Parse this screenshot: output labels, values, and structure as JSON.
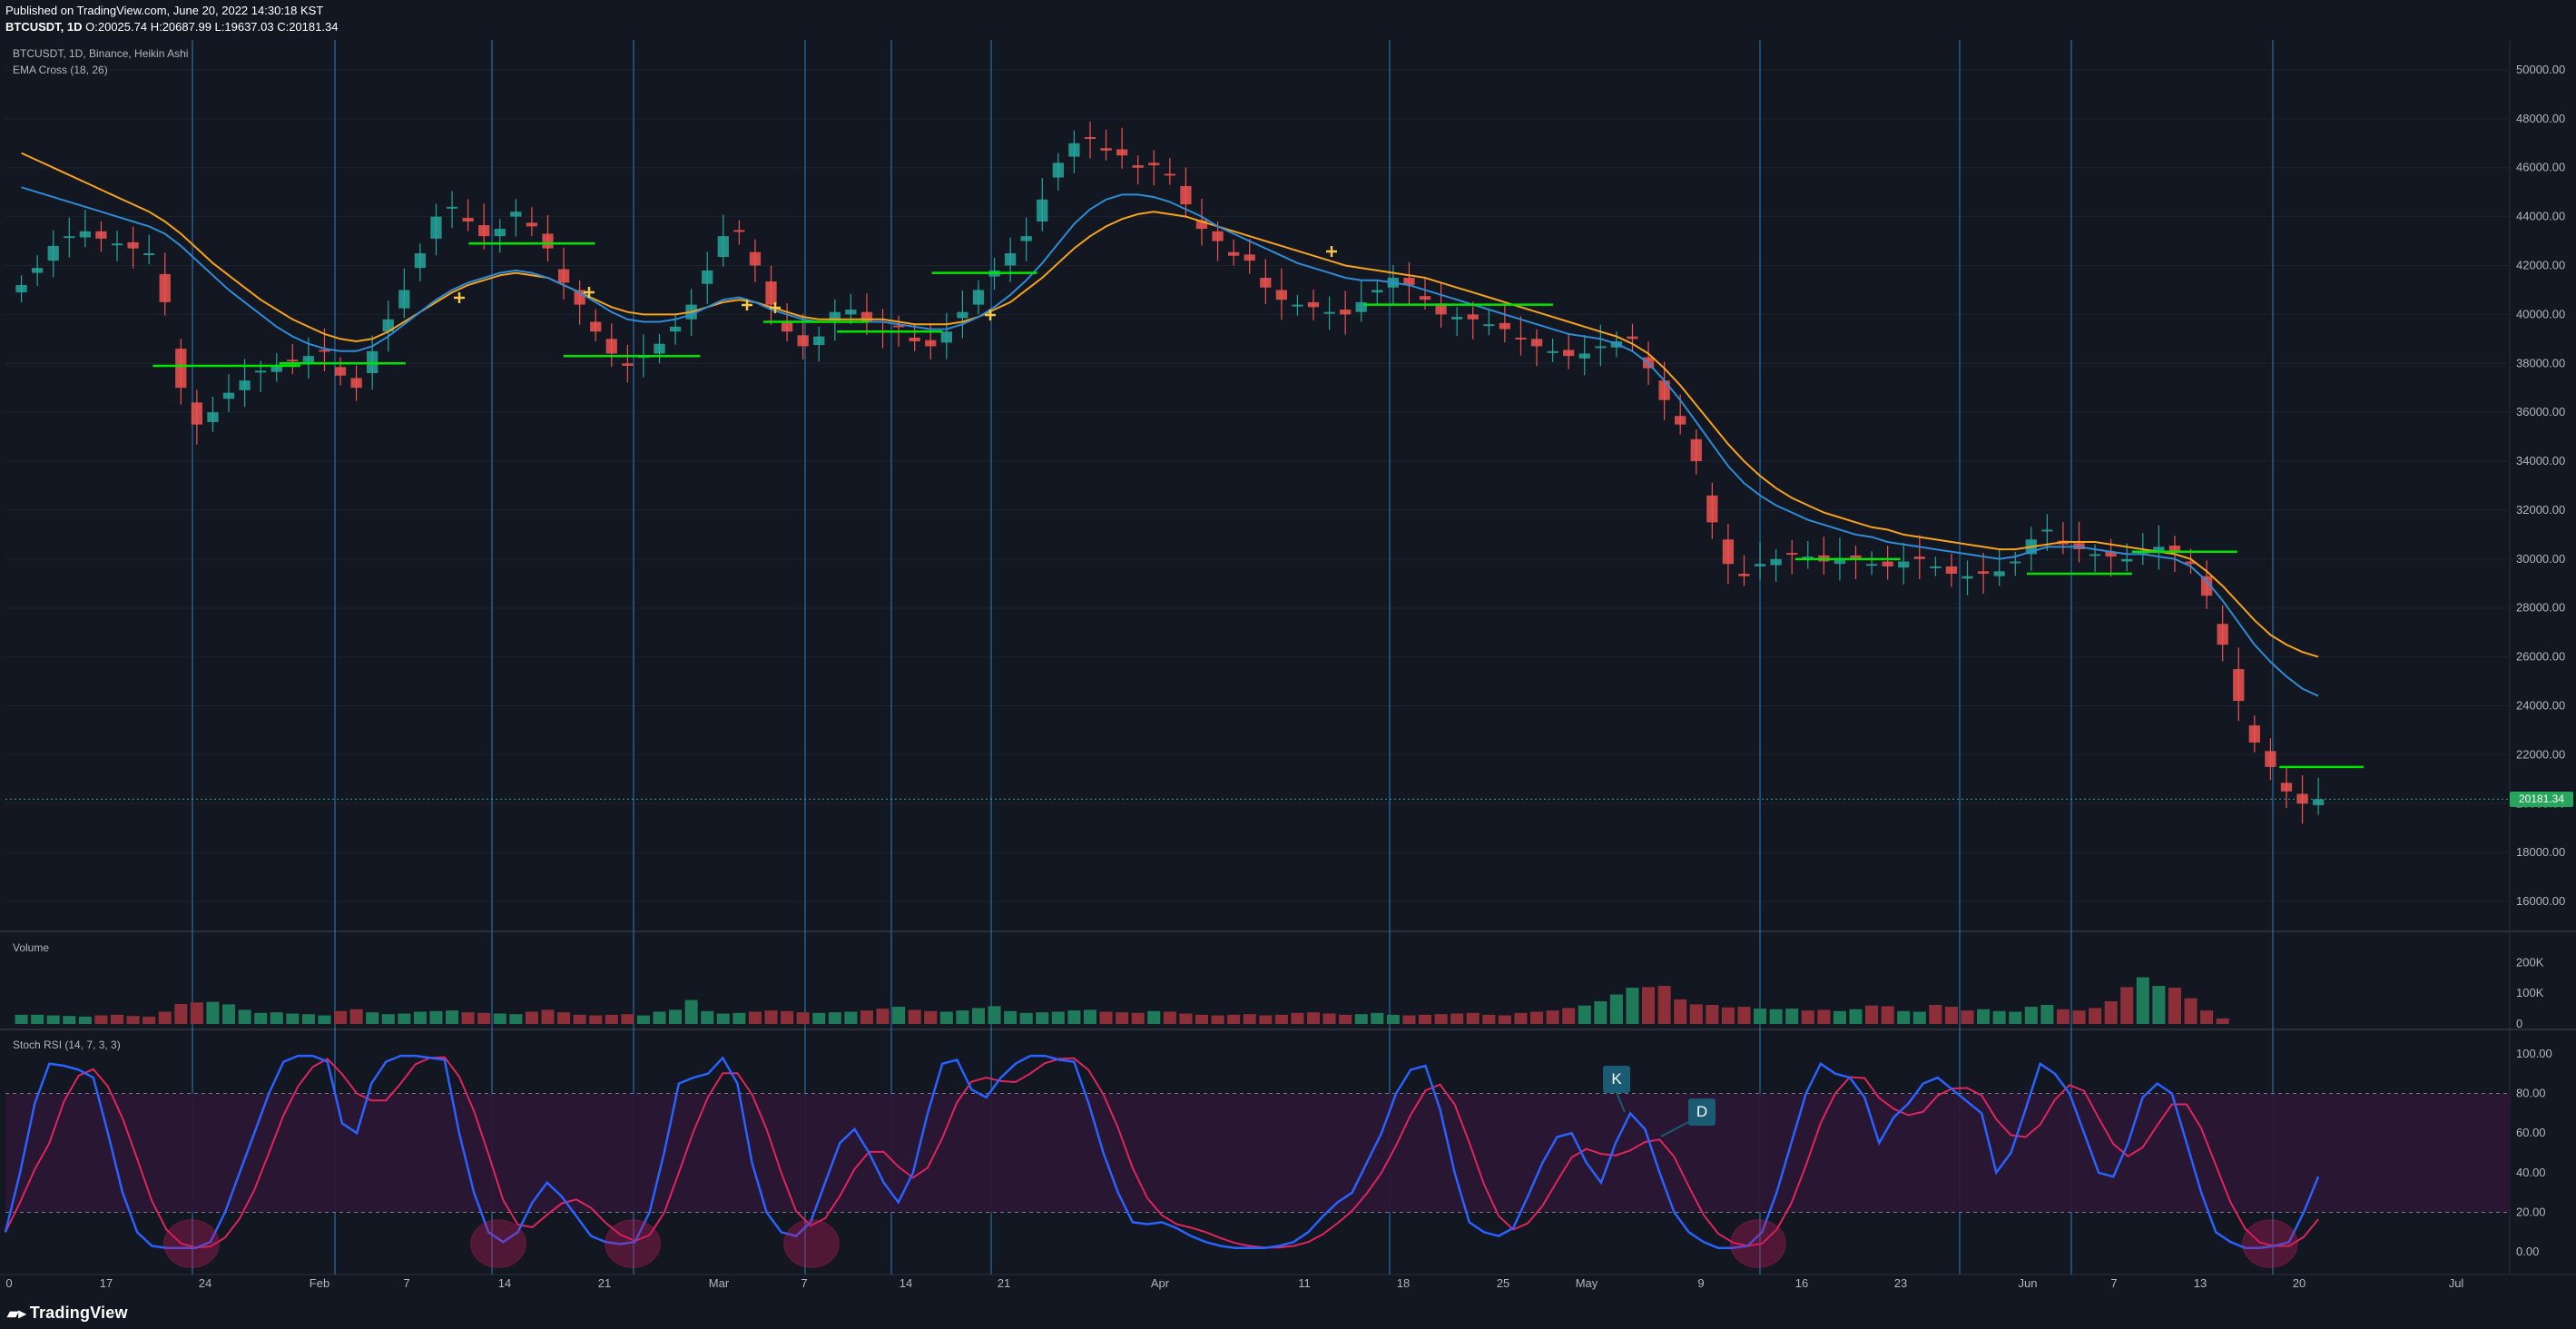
{
  "header": {
    "published": "Published on TradingView.com, June 20, 2022 14:30:18 KST",
    "symbol": "BTCUSDT, 1D",
    "ohlc": "O:20025.74 H:20687.99 L:19637.03 C:20181.34"
  },
  "legend": {
    "main": "BTCUSDT, 1D, Binance, Heikin Ashi",
    "ema": "EMA Cross (18, 26)",
    "volume": "Volume",
    "stoch": "Stoch RSI (14, 7, 3, 3)"
  },
  "price_axis": [
    "50000.00",
    "48000.00",
    "46000.00",
    "44000.00",
    "42000.00",
    "40000.00",
    "38000.00",
    "36000.00",
    "34000.00",
    "32000.00",
    "30000.00",
    "28000.00",
    "26000.00",
    "24000.00",
    "22000.00",
    "20000.00",
    "18000.00",
    "16000.00"
  ],
  "last_price": "20181.34",
  "volume_axis": [
    "200K",
    "100K",
    "0"
  ],
  "stoch_axis": [
    "100.00",
    "80.00",
    "60.00",
    "40.00",
    "20.00",
    "0.00"
  ],
  "time_axis": [
    "0",
    "17",
    "24",
    "Feb",
    "7",
    "14",
    "21",
    "Mar",
    "7",
    "14",
    "21",
    "Apr",
    "11",
    "18",
    "25",
    "May",
    "9",
    "16",
    "23",
    "Jun",
    "7",
    "13",
    "20",
    "Jul"
  ],
  "callouts": {
    "k": "K",
    "d": "D"
  },
  "footer": {
    "brand": "TradingView"
  },
  "colors": {
    "up": "#26a69a",
    "down": "#ef5350",
    "ema_fast": "#2e8bd6",
    "ema_slow": "#f7a21b",
    "support": "#00e600",
    "k": "#2962ff",
    "d": "#e0245e"
  },
  "chart_data": {
    "type": "candlestick",
    "price_ylim": [
      15000,
      51000
    ],
    "price_series": [
      41200,
      41900,
      42800,
      43200,
      43400,
      43100,
      42900,
      42700,
      42500,
      40500,
      37000,
      35500,
      36000,
      36800,
      37300,
      37700,
      37900,
      38100,
      38300,
      38500,
      37500,
      37000,
      38500,
      39800,
      41000,
      42500,
      44000,
      44400,
      43800,
      43200,
      43500,
      44200,
      43600,
      42700,
      41300,
      40400,
      39300,
      38400,
      37900,
      38300,
      38800,
      39500,
      40400,
      41800,
      43200,
      43400,
      42000,
      40400,
      39300,
      38700,
      39100,
      40100,
      40200,
      39700,
      39300,
      39500,
      38900,
      38700,
      39300,
      40100,
      41000,
      41800,
      42500,
      43200,
      44700,
      46200,
      47000,
      47200,
      46700,
      46500,
      46000,
      46100,
      45700,
      44500,
      43500,
      43000,
      42400,
      42200,
      41100,
      40600,
      40400,
      40300,
      40100,
      40000,
      40500,
      41000,
      41500,
      41200,
      40600,
      40000,
      39900,
      39800,
      39600,
      39400,
      39000,
      38700,
      38500,
      38300,
      38400,
      38700,
      38900,
      39000,
      37800,
      36500,
      35500,
      34000,
      31500,
      29800,
      29300,
      29800,
      30000,
      30200,
      30100,
      29900,
      30000,
      30000,
      29800,
      29700,
      29900,
      30000,
      29700,
      29400,
      29300,
      29400,
      29500,
      29900,
      30800,
      31200,
      30600,
      30400,
      30200,
      30100,
      30000,
      30300,
      30500,
      30300,
      29800,
      28500,
      26500,
      24200,
      22500,
      21500,
      20500,
      20000,
      20181
    ],
    "ema_fast": [
      45200,
      45000,
      44800,
      44600,
      44400,
      44200,
      44000,
      43800,
      43600,
      43300,
      42800,
      42200,
      41600,
      41000,
      40500,
      40000,
      39500,
      39100,
      38800,
      38600,
      38500,
      38500,
      38700,
      39100,
      39600,
      40100,
      40600,
      41000,
      41300,
      41500,
      41700,
      41800,
      41700,
      41500,
      41200,
      40900,
      40500,
      40100,
      39800,
      39700,
      39700,
      39800,
      40000,
      40300,
      40600,
      40700,
      40500,
      40200,
      40000,
      39800,
      39700,
      39700,
      39700,
      39700,
      39700,
      39600,
      39500,
      39400,
      39400,
      39600,
      39900,
      40300,
      40800,
      41400,
      42100,
      42900,
      43700,
      44300,
      44700,
      44900,
      44900,
      44800,
      44600,
      44300,
      44000,
      43600,
      43300,
      43000,
      42700,
      42400,
      42100,
      41900,
      41700,
      41500,
      41400,
      41400,
      41300,
      41200,
      41000,
      40800,
      40600,
      40400,
      40200,
      40000,
      39800,
      39600,
      39400,
      39200,
      39100,
      39000,
      38800,
      38500,
      38000,
      37300,
      36500,
      35600,
      34700,
      33800,
      33100,
      32600,
      32200,
      31900,
      31600,
      31400,
      31200,
      31000,
      30900,
      30700,
      30600,
      30500,
      30400,
      30300,
      30200,
      30100,
      30000,
      30100,
      30300,
      30500,
      30500,
      30500,
      30400,
      30300,
      30200,
      30200,
      30100,
      30000,
      29700,
      29100,
      28300,
      27400,
      26500,
      25800,
      25200,
      24700,
      24400
    ],
    "ema_slow": [
      46600,
      46300,
      46000,
      45700,
      45400,
      45100,
      44800,
      44500,
      44200,
      43800,
      43300,
      42700,
      42100,
      41600,
      41100,
      40600,
      40200,
      39800,
      39500,
      39200,
      39000,
      38900,
      39000,
      39300,
      39700,
      40100,
      40500,
      40900,
      41200,
      41400,
      41600,
      41700,
      41600,
      41500,
      41200,
      40900,
      40600,
      40300,
      40100,
      40000,
      40000,
      40000,
      40100,
      40300,
      40500,
      40600,
      40500,
      40300,
      40100,
      39900,
      39800,
      39800,
      39800,
      39800,
      39800,
      39700,
      39600,
      39600,
      39600,
      39700,
      39900,
      40200,
      40500,
      41000,
      41500,
      42100,
      42700,
      43200,
      43600,
      43900,
      44100,
      44200,
      44100,
      44000,
      43800,
      43600,
      43400,
      43200,
      43000,
      42800,
      42600,
      42400,
      42200,
      42000,
      41900,
      41800,
      41700,
      41600,
      41500,
      41300,
      41100,
      40900,
      40700,
      40500,
      40300,
      40100,
      39900,
      39700,
      39500,
      39300,
      39100,
      38800,
      38400,
      37800,
      37100,
      36300,
      35500,
      34700,
      34000,
      33400,
      32900,
      32500,
      32200,
      31900,
      31700,
      31500,
      31300,
      31200,
      31000,
      30900,
      30800,
      30700,
      30600,
      30500,
      30400,
      30400,
      30500,
      30600,
      30700,
      30700,
      30700,
      30600,
      30500,
      30400,
      30300,
      30200,
      30000,
      29500,
      28900,
      28200,
      27500,
      26900,
      26500,
      26200,
      26000
    ],
    "volume": [
      30,
      30,
      28,
      26,
      24,
      28,
      30,
      26,
      24,
      40,
      65,
      70,
      72,
      64,
      46,
      36,
      38,
      34,
      32,
      28,
      42,
      48,
      38,
      32,
      34,
      40,
      42,
      44,
      38,
      36,
      34,
      32,
      40,
      46,
      38,
      30,
      28,
      30,
      32,
      28,
      40,
      46,
      78,
      42,
      34,
      36,
      40,
      44,
      42,
      38,
      36,
      38,
      40,
      44,
      50,
      56,
      46,
      42,
      40,
      44,
      52,
      58,
      42,
      36,
      38,
      40,
      44,
      46,
      40,
      38,
      36,
      42,
      40,
      34,
      30,
      28,
      30,
      32,
      28,
      30,
      36,
      38,
      34,
      30,
      32,
      36,
      30,
      28,
      30,
      32,
      34,
      36,
      30,
      28,
      36,
      40,
      44,
      52,
      60,
      74,
      96,
      118,
      120,
      124,
      80,
      64,
      62,
      54,
      56,
      50,
      48,
      50,
      44,
      46,
      42,
      48,
      60,
      58,
      42,
      40,
      62,
      56,
      44,
      48,
      42,
      40,
      56,
      62,
      48,
      44,
      52,
      74,
      120,
      152,
      124,
      118,
      84,
      44,
      18
    ],
    "vol_ylim": [
      0,
      260
    ],
    "stoch_k": [
      10,
      40,
      75,
      95,
      94,
      92,
      88,
      60,
      30,
      10,
      3,
      2,
      2,
      2,
      5,
      20,
      40,
      60,
      80,
      96,
      99,
      99,
      96,
      65,
      60,
      85,
      96,
      99,
      99,
      98,
      97,
      60,
      30,
      10,
      5,
      10,
      25,
      35,
      28,
      18,
      8,
      5,
      4,
      5,
      20,
      50,
      85,
      88,
      90,
      98,
      85,
      45,
      20,
      10,
      8,
      15,
      35,
      55,
      62,
      50,
      35,
      25,
      40,
      70,
      95,
      97,
      82,
      78,
      88,
      95,
      99,
      99,
      97,
      96,
      75,
      50,
      30,
      15,
      14,
      15,
      12,
      8,
      5,
      3,
      2,
      2,
      2,
      3,
      5,
      10,
      18,
      25,
      30,
      45,
      60,
      80,
      92,
      94,
      72,
      40,
      15,
      10,
      8,
      12,
      28,
      45,
      58,
      60,
      45,
      35,
      55,
      70,
      62,
      40,
      20,
      10,
      5,
      2,
      2,
      3,
      10,
      30,
      55,
      80,
      95,
      90,
      88,
      78,
      55,
      68,
      75,
      85,
      88,
      82,
      76,
      70,
      40,
      50,
      72,
      95,
      90,
      80,
      60,
      40,
      38,
      55,
      78,
      85,
      80,
      55,
      30,
      10,
      5,
      2,
      2,
      3,
      5,
      20,
      38
    ]
  }
}
